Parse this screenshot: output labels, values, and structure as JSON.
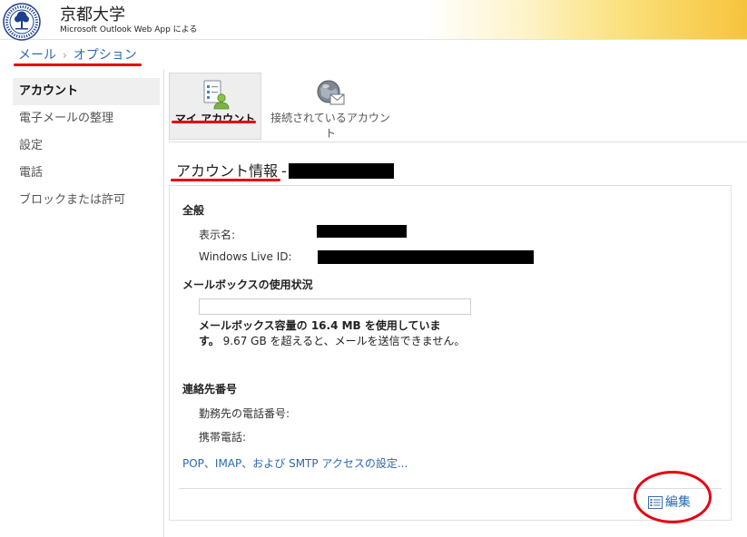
{
  "header": {
    "org_name": "京都大学",
    "app_name": "Microsoft Outlook Web App による",
    "logo_icon": "university-seal-icon"
  },
  "breadcrumb": {
    "root": "メール",
    "separator": "›",
    "current": "オプション"
  },
  "sidebar": {
    "items": [
      {
        "label": "アカウント",
        "selected": true
      },
      {
        "label": "電子メールの整理",
        "selected": false
      },
      {
        "label": "設定",
        "selected": false
      },
      {
        "label": "電話",
        "selected": false
      },
      {
        "label": "ブロックまたは許可",
        "selected": false
      }
    ]
  },
  "toolbar": {
    "my_account": {
      "label": "マイ アカウント",
      "icon": "account-settings-icon",
      "selected": true
    },
    "connected_accounts": {
      "label": "接続されているアカウント",
      "icon": "connected-accounts-icon",
      "selected": false
    }
  },
  "page": {
    "title": "アカウント情報",
    "title_separator": "-"
  },
  "general": {
    "heading": "全般",
    "display_name_label": "表示名:",
    "live_id_label": "Windows Live ID:"
  },
  "mailbox": {
    "heading": "メールボックスの使用状況",
    "usage_fraction": 0.0,
    "usage_prefix": "メールボックス容量の ",
    "usage_amount": "16.4 MB",
    "usage_suffix": " を使用しています。",
    "limit_text": "9.67 GB を超えると、メールを送信できません。"
  },
  "contact": {
    "heading": "連絡先番号",
    "work_phone_label": "勤務先の電話番号:",
    "mobile_phone_label": "携帯電話:"
  },
  "links": {
    "pop_imap": "POP、IMAP、および SMTP アクセスの設定..."
  },
  "actions": {
    "edit_label": "編集",
    "edit_icon": "edit-list-icon"
  },
  "colors": {
    "link": "#2a6ab0",
    "annotation_red": "#e60012",
    "header_gold": "#f6c43c"
  }
}
